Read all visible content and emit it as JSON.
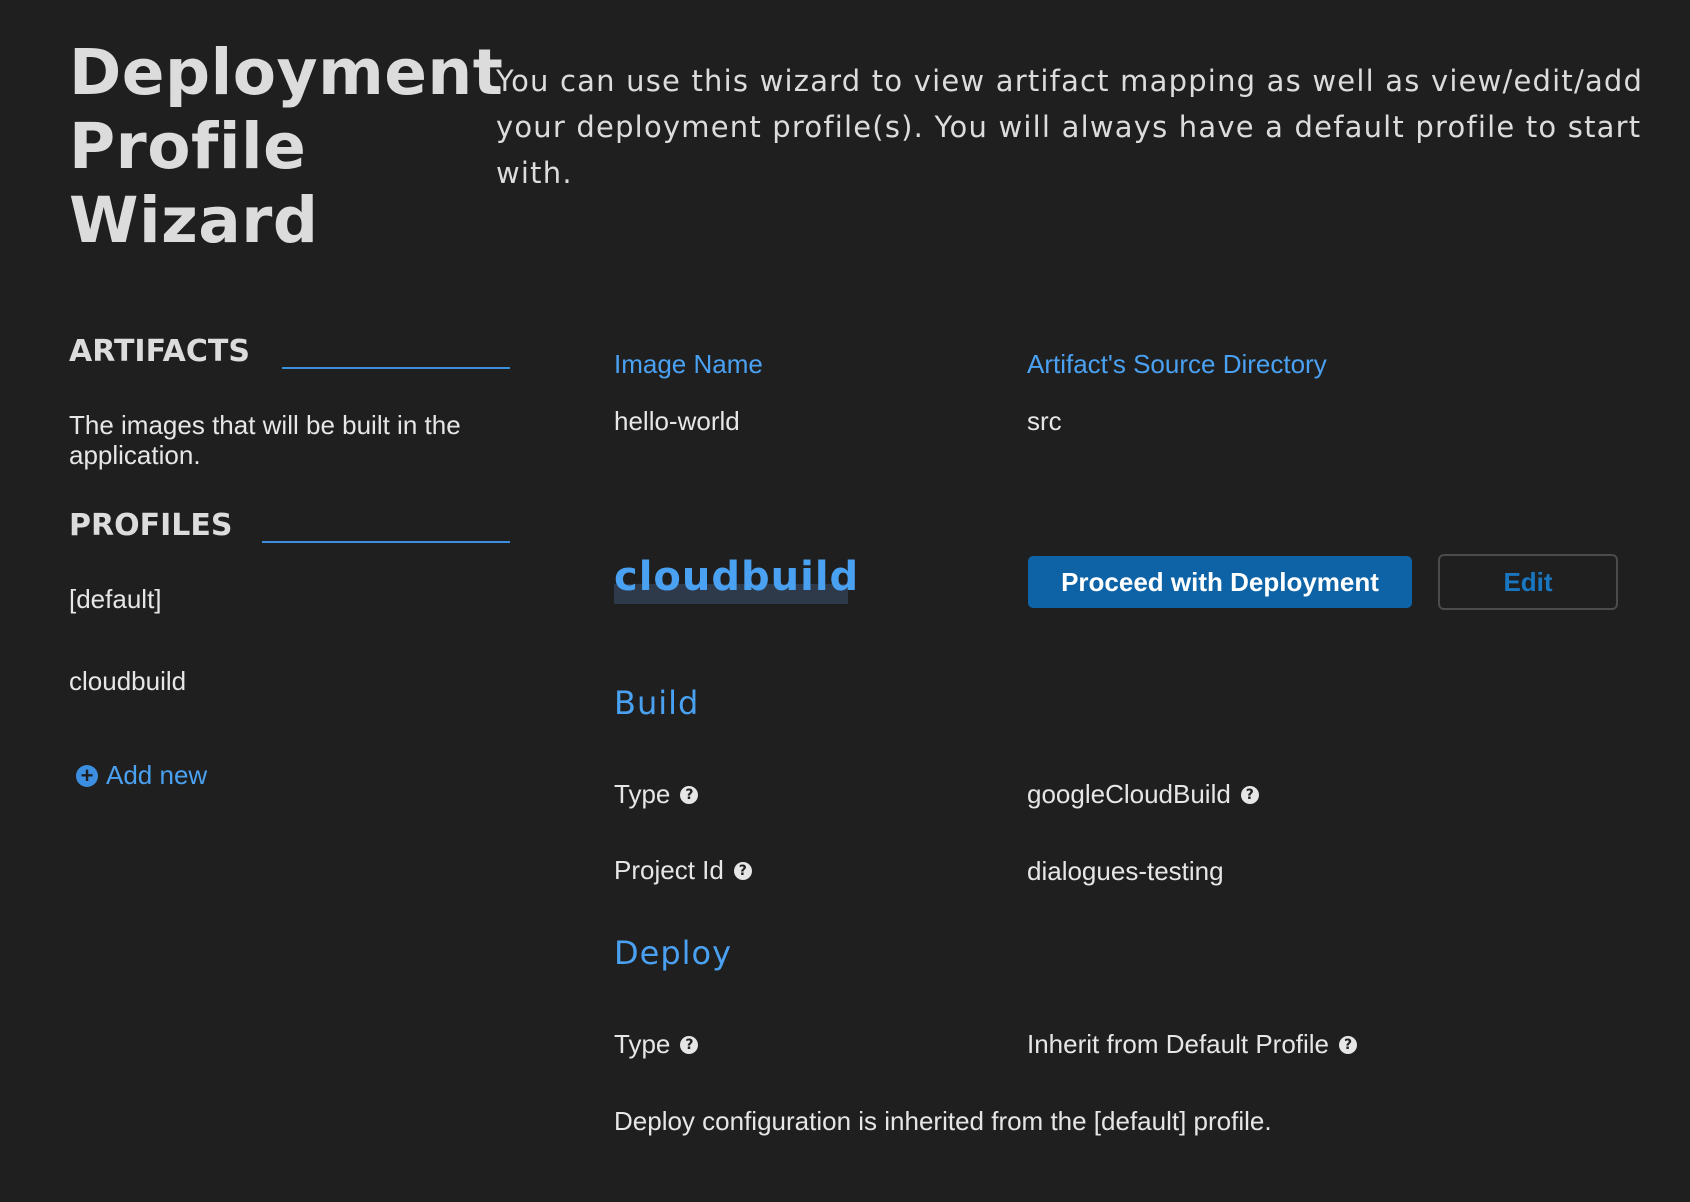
{
  "header": {
    "title_lines": [
      "Deployment",
      "Profile",
      "Wizard"
    ],
    "intro": "You can use this wizard to view artifact mapping as well as view/edit/add your deployment profile(s). You will always have a default profile to start with."
  },
  "sidebar": {
    "artifacts_heading": "ARTIFACTS",
    "artifacts_description": "The images that will be built in the application.",
    "profiles_heading": "PROFILES",
    "profiles": [
      "[default]",
      "cloudbuild"
    ],
    "add_new_label": "Add new"
  },
  "artifacts_table": {
    "columns": [
      "Image Name",
      "Artifact's Source Directory"
    ],
    "rows": [
      [
        "hello-world",
        "src"
      ]
    ]
  },
  "profile": {
    "name": "cloudbuild",
    "proceed_label": "Proceed with Deployment",
    "edit_label": "Edit",
    "build": {
      "heading": "Build",
      "type_label": "Type",
      "type_value": "googleCloudBuild",
      "project_label": "Project Id",
      "project_value": "dialogues-testing"
    },
    "deploy": {
      "heading": "Deploy",
      "type_label": "Type",
      "type_value": "Inherit from Default Profile",
      "note": "Deploy configuration is inherited from the [default] profile."
    }
  },
  "icons": {
    "help": "question-circle-icon",
    "add": "plus-circle-icon"
  },
  "colors": {
    "background": "#1f1f1f",
    "accent": "#4aa1f2",
    "primary_button": "#0e63a6"
  }
}
